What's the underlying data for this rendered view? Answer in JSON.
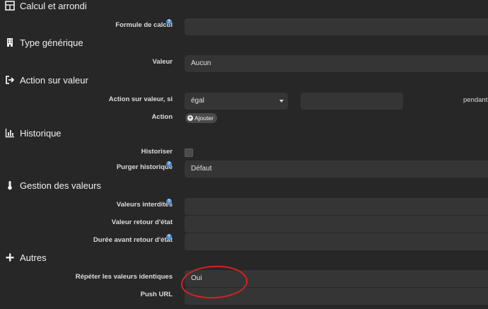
{
  "sections": {
    "calcul": {
      "title": "Calcul et arrondi",
      "icon": "table-icon"
    },
    "type": {
      "title": "Type générique",
      "icon": "building-icon"
    },
    "action": {
      "title": "Action sur valeur",
      "icon": "sign-out-icon"
    },
    "historique": {
      "title": "Historique",
      "icon": "bar-chart-icon"
    },
    "gestion": {
      "title": "Gestion des valeurs",
      "icon": "thermometer-icon"
    },
    "autres": {
      "title": "Autres",
      "icon": "plus-icon"
    }
  },
  "fields": {
    "formule_label": "Formule de calcul",
    "formule_value": "",
    "valeur_label": "Valeur",
    "valeur_value": "Aucun",
    "action_si_label": "Action sur valeur, si",
    "action_si_value": "égal",
    "pendant_label": "pendant",
    "action_label": "Action",
    "ajouter_label": "Ajouter",
    "historiser_label": "Historiser",
    "purger_label": "Purger historique",
    "purger_value": "Défaut",
    "interdites_label": "Valeurs interdites",
    "retour_label": "Valeur retour d'état",
    "duree_label": "Durée avant retour d'état",
    "repeter_label": "Répéter les valeurs identiques",
    "repeter_value": "Oui",
    "push_label": "Push URL"
  },
  "colors": {
    "accent": "#4b8ed1",
    "annotation": "#d42222",
    "background": "#272727",
    "field": "#353535"
  }
}
